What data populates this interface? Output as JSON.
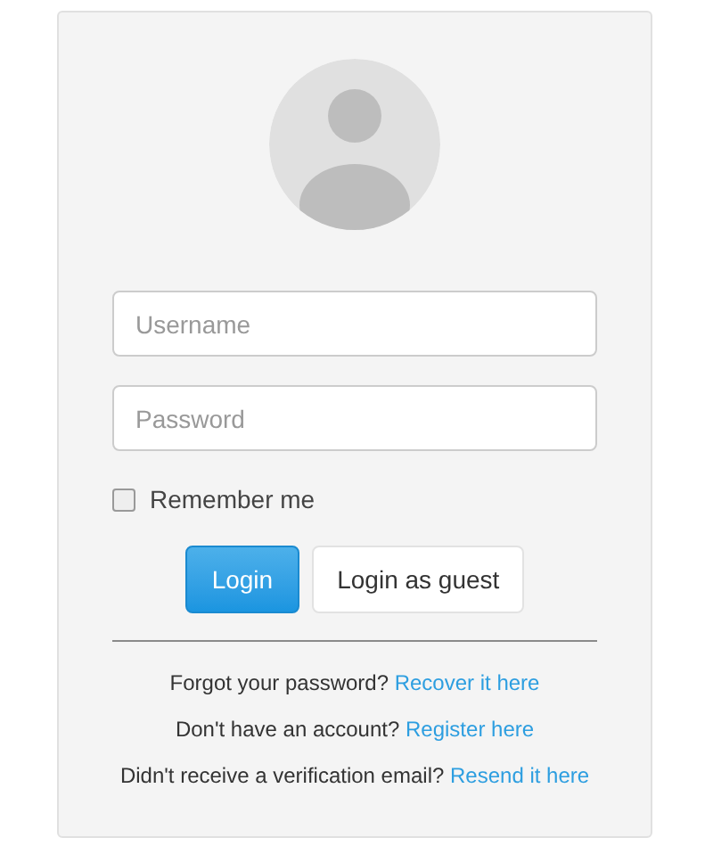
{
  "fields": [
    {
      "placeholder": "Username"
    },
    {
      "placeholder": "Password"
    }
  ],
  "remember": {
    "label": "Remember me",
    "checked": false
  },
  "buttons": [
    {
      "label": "Login",
      "kind": "primary"
    },
    {
      "label": "Login as guest",
      "kind": "default"
    }
  ],
  "help_lines": [
    {
      "text": "Forgot your password?",
      "link": "Recover it here"
    },
    {
      "text": "Don't have an account?",
      "link": "Register here"
    },
    {
      "text": "Didn't receive a verification email?",
      "link": "Resend it here"
    }
  ]
}
